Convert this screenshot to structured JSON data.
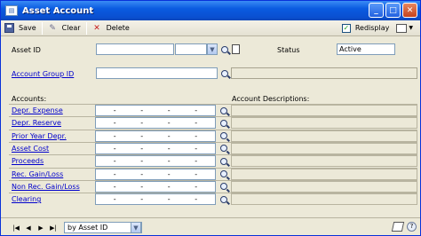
{
  "window": {
    "title": "Asset Account",
    "icon": "asset-account-window-icon",
    "controls": [
      "minimize",
      "maximize",
      "close"
    ]
  },
  "toolbar": {
    "save_label": "Save",
    "clear_label": "Clear",
    "delete_label": "Delete",
    "redisplay_label": "Redisplay",
    "redisplay_checked": true
  },
  "form": {
    "asset_id_label": "Asset ID",
    "asset_id_value": "",
    "status_label": "Status",
    "status_value": "Active",
    "account_group_label": "Account Group ID",
    "account_group_value": "",
    "accounts_header": "Accounts:",
    "descriptions_header": "Account Descriptions:",
    "accounts": [
      {
        "label": "Depr. Expense",
        "segments": [
          "-",
          "-",
          "-",
          "-"
        ],
        "description": ""
      },
      {
        "label": "Depr. Reserve",
        "segments": [
          "-",
          "-",
          "-",
          "-"
        ],
        "description": ""
      },
      {
        "label": "Prior Year Depr.",
        "segments": [
          "-",
          "-",
          "-",
          "-"
        ],
        "description": ""
      },
      {
        "label": "Asset Cost",
        "segments": [
          "-",
          "-",
          "-",
          "-"
        ],
        "description": ""
      },
      {
        "label": "Proceeds",
        "segments": [
          "-",
          "-",
          "-",
          "-"
        ],
        "description": ""
      },
      {
        "label": "Rec. Gain/Loss",
        "segments": [
          "-",
          "-",
          "-",
          "-"
        ],
        "description": ""
      },
      {
        "label": "Non Rec. Gain/Loss",
        "segments": [
          "-",
          "-",
          "-",
          "-"
        ],
        "description": ""
      },
      {
        "label": "Clearing",
        "segments": [
          "-",
          "-",
          "-",
          "-"
        ],
        "description": ""
      }
    ]
  },
  "bottom": {
    "sort_value": "by Asset ID"
  },
  "colors": {
    "titlebar": "#0a5be0",
    "link": "#0000cc",
    "window_bg": "#ece9d8"
  }
}
